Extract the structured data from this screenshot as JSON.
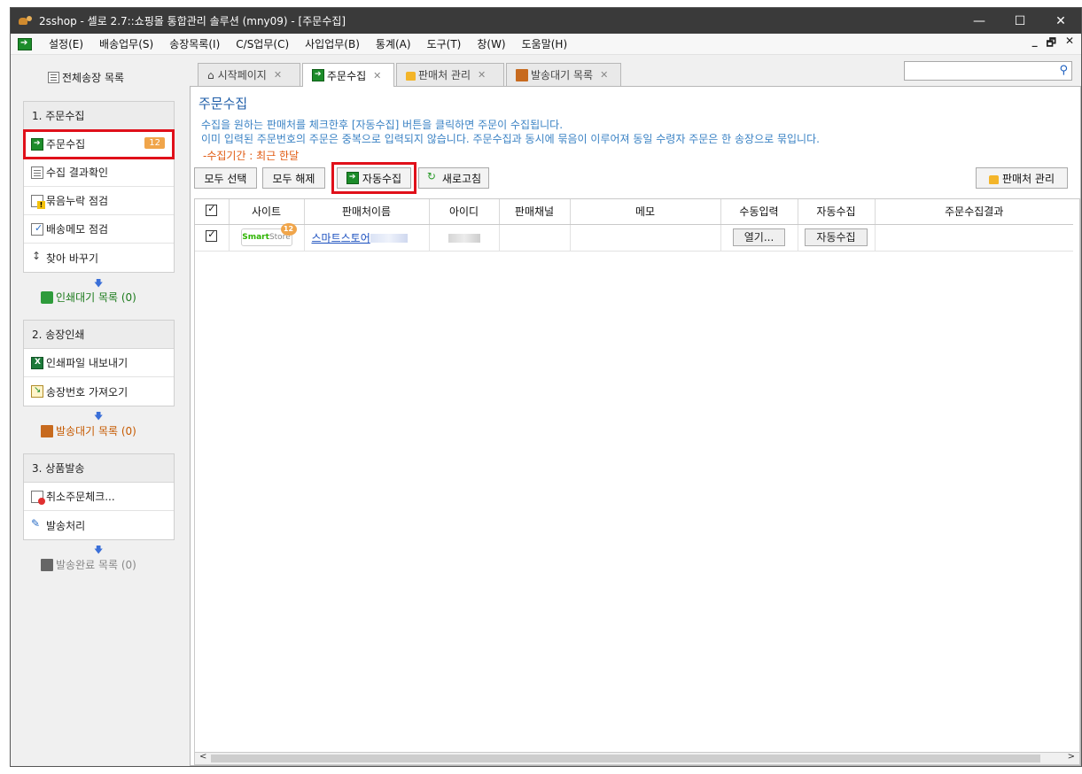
{
  "window": {
    "title": "2sshop - 셀로 2.7::쇼핑몰 통합관리 솔루션 (mny09) - [주문수집]",
    "controls": [
      "—",
      "☐",
      "✕"
    ]
  },
  "menubar": {
    "items": [
      "설정(E)",
      "배송업무(S)",
      "송장목록(I)",
      "C/S업무(C)",
      "사입업무(B)",
      "통계(A)",
      "도구(T)",
      "창(W)",
      "도움말(H)"
    ],
    "mdi_controls": [
      "_",
      "🗗",
      "✕"
    ]
  },
  "sidebar": {
    "all_invoices": "전체송장 목록",
    "section1": {
      "header": "1. 주문수집",
      "items": [
        "주문수집",
        "수집 결과확인",
        "묶음누락 점검",
        "배송메모 점검",
        "찾아 바꾸기"
      ],
      "badge": "12"
    },
    "print_wait": "인쇄대기 목록 (0)",
    "section2": {
      "header": "2. 송장인쇄",
      "items": [
        "인쇄파일 내보내기",
        "송장번호 가져오기"
      ]
    },
    "ship_wait": "발송대기 목록 (0)",
    "section3": {
      "header": "3. 상품발송",
      "items": [
        "취소주문체크...",
        "발송처리"
      ]
    },
    "ship_done": "발송완료 목록 (0)",
    "arrow": "🡇"
  },
  "tabs": [
    {
      "label": "시작페이지",
      "close": "✕"
    },
    {
      "label": "주문수집",
      "close": "✕"
    },
    {
      "label": "판매처 관리",
      "close": "✕"
    },
    {
      "label": "발송대기 목록",
      "close": "✕"
    }
  ],
  "search": {
    "icon": "search-icon",
    "glyph": "⚲"
  },
  "main": {
    "title": "주문수집",
    "desc1": "수집을 원하는 판매처를 체크한후 [자동수집] 버튼을 클릭하면 주문이 수집됩니다.",
    "desc2": "이미 입력된 주문번호의 주문은 중복으로 입력되지 않습니다. 주문수집과 동시에 묶음이 이루어져 동일 수령자 주문은 한 송장으로 묶입니다.",
    "period": "-수집기간 : 최근 한달",
    "buttons": {
      "select_all": "모두 선택",
      "deselect_all": "모두 해제",
      "auto_collect": "자동수집",
      "refresh": "새로고침",
      "seller_manage": "판매처 관리"
    }
  },
  "table": {
    "columns": [
      "사이트",
      "판매처이름",
      "아이디",
      "판매채널",
      "메모",
      "수동입력",
      "자동수집",
      "주문수집결과"
    ],
    "rows": [
      {
        "site": "SmartStore",
        "site_part1": "Smart",
        "site_part2": "Store",
        "site_badge": "12",
        "seller_name": "스마트스토어",
        "id": "",
        "channel": "",
        "memo": "",
        "manual_btn": "열기...",
        "auto_btn": "자동수집",
        "result": ""
      }
    ]
  },
  "scroll": {
    "left": "<",
    "right": ">"
  },
  "colors": {
    "accent_blue": "#1f5ea8",
    "highlight_red": "#e0101a",
    "badge_orange": "#f0a54a",
    "link_blue": "#1a4fbf",
    "period_orange": "#e05a12"
  }
}
